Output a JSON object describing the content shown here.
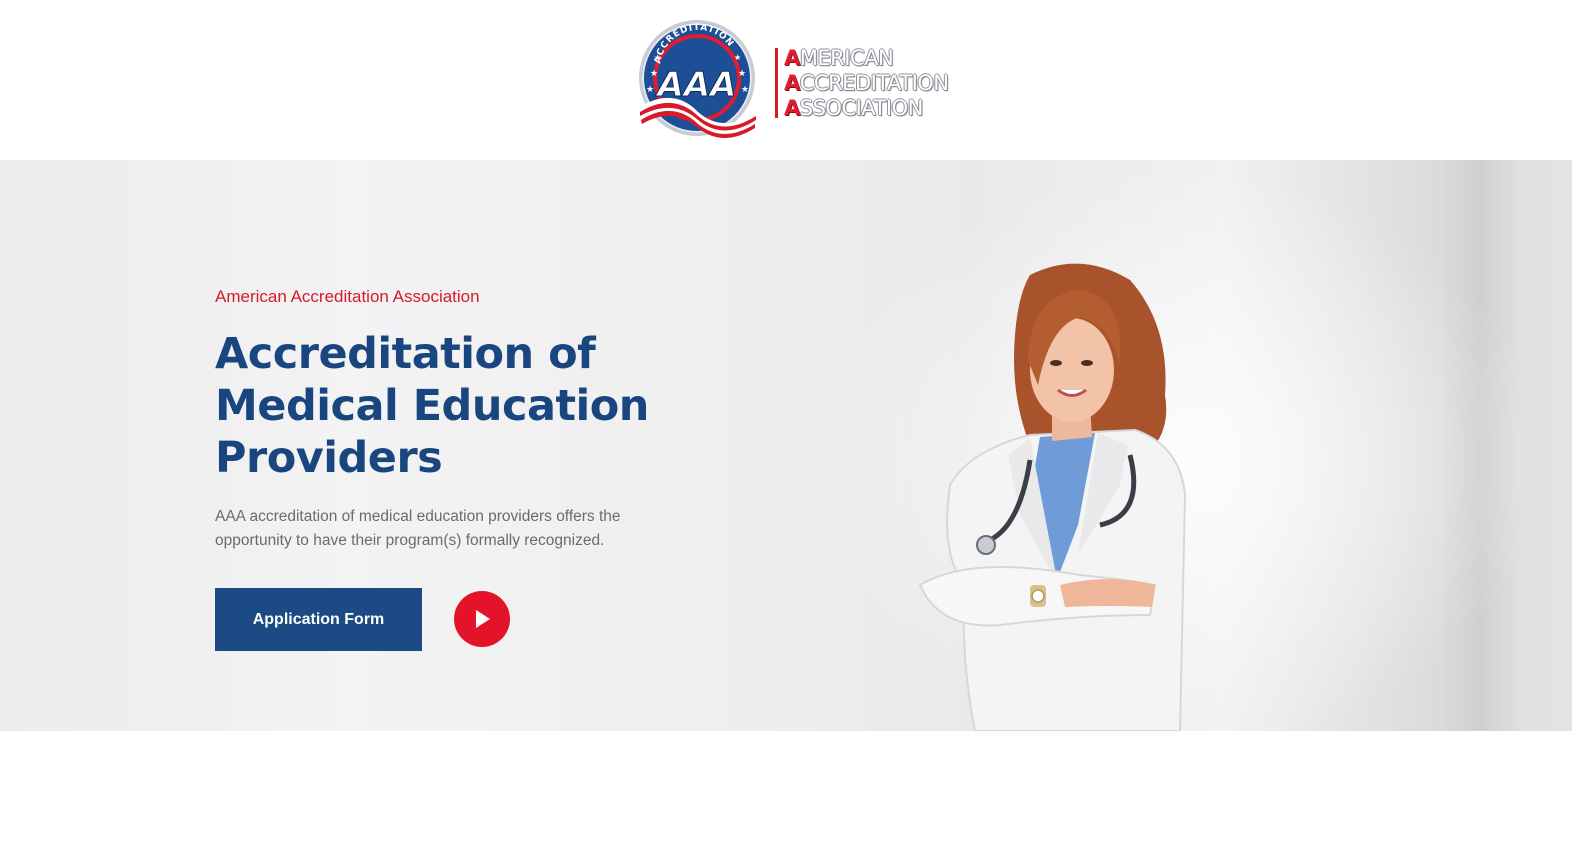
{
  "header": {
    "logo": {
      "seal_text": "ACCREDITATION",
      "seal_initials": "AAA",
      "wordmark": [
        {
          "initial": "A",
          "rest": "MERICAN"
        },
        {
          "initial": "A",
          "rest": "CCREDITATION"
        },
        {
          "initial": "A",
          "rest": "SSOCIATION"
        }
      ]
    }
  },
  "hero": {
    "eyebrow": "American Accreditation Association",
    "title": "Accreditation of Medical Education Providers",
    "description": "AAA accreditation of medical education providers offers the opportunity to have their program(s) formally recognized.",
    "primary_button": "Application Form",
    "play_icon": "play-icon",
    "image": "doctor-photo"
  },
  "colors": {
    "brand_blue": "#1b4a84",
    "brand_red": "#e3132a",
    "title_blue": "#1a4680"
  }
}
